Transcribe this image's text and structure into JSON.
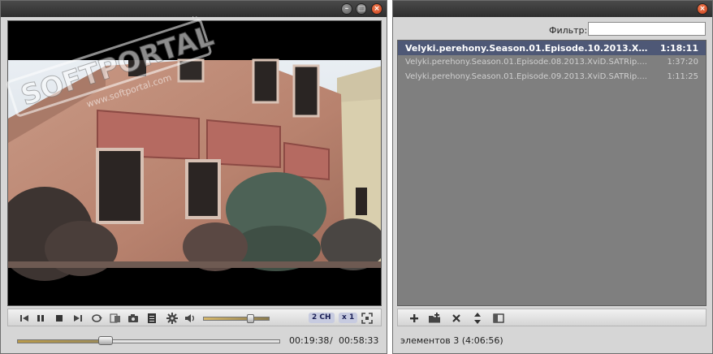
{
  "player": {
    "window_buttons": {
      "minimize": "–",
      "maximize": "□",
      "close": "×"
    },
    "controls": {
      "audio_channels": "2 CH",
      "speed": "x 1",
      "volume_level": 0.72
    },
    "seek": {
      "position_fraction": 0.3357,
      "current_time": "00:19:38",
      "separator": "/",
      "total_time": "00:58:33"
    }
  },
  "playlist_window": {
    "window_buttons": {
      "close": "×"
    },
    "filter": {
      "label": "Фильтр:",
      "value": ""
    },
    "items": [
      {
        "title": "Velyki.perehony.Season.01.Episode.10.2013.XviD.S...",
        "duration": "1:18:11",
        "active": true
      },
      {
        "title": "Velyki.perehony.Season.01.Episode.08.2013.XviD.SATRip....",
        "duration": "1:37:20",
        "active": false
      },
      {
        "title": "Velyki.perehony.Season.01.Episode.09.2013.XviD.SATRip....",
        "duration": "1:11:25",
        "active": false
      }
    ],
    "status": "элементов 3 (4:06:56)"
  },
  "watermark": {
    "brand": "SOFTPORTAL",
    "url": "www.softportal.com",
    "trademark": "TM"
  },
  "colors": {
    "selected_row": "#4e5876",
    "playlist_bg": "#7f7f7f",
    "close_button": "#d4502a",
    "pill": "#c7cbe0"
  },
  "icons": [
    "previous-icon",
    "pause-icon",
    "stop-icon",
    "next-icon",
    "loop-icon",
    "subtitles-icon",
    "snapshot-icon",
    "playlist-icon",
    "settings-icon",
    "volume-icon",
    "fullscreen-icon",
    "add-icon",
    "add-folder-icon",
    "remove-icon",
    "sort-icon",
    "view-toggle-icon"
  ]
}
